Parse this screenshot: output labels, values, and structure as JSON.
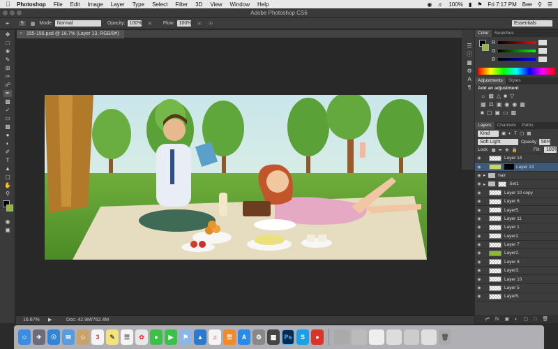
{
  "menubar": {
    "app": "Photoshop",
    "items": [
      "File",
      "Edit",
      "Image",
      "Layer",
      "Type",
      "Select",
      "Filter",
      "3D",
      "View",
      "Window",
      "Help"
    ],
    "battery": "100%",
    "clock": "Fri 7:17 PM",
    "user": "Bee"
  },
  "window": {
    "title": "Adobe Photoshop CS6"
  },
  "options": {
    "brush_size": "5",
    "mode_label": "Mode:",
    "mode_value": "Normal",
    "opacity_label": "Opacity:",
    "opacity_value": "100%",
    "flow_label": "Flow:",
    "flow_value": "100%",
    "workspace": "Essentials"
  },
  "document": {
    "tab": "155-156.psd @ 16.7% (Layer 13, RGB/8#)"
  },
  "status": {
    "zoom": "16.67%",
    "doc": "Doc: 42.9M/762.4M"
  },
  "color_panel": {
    "tabs": [
      "Color",
      "Swatches"
    ],
    "channels": [
      "R",
      "G",
      "B"
    ]
  },
  "adjustments_panel": {
    "tabs": [
      "Adjustments",
      "Styles"
    ],
    "heading": "Add an adjustment"
  },
  "layers_panel": {
    "tabs": [
      "Layers",
      "Channels",
      "Paths"
    ],
    "kind": "Kind",
    "blend_mode": "Soft Light",
    "opacity_label": "Opacity:",
    "opacity_value": "56%",
    "lock_label": "Lock:",
    "fill_label": "Fill:",
    "fill_value": "100%",
    "layers": [
      {
        "name": "Layer 14",
        "type": "layer"
      },
      {
        "name": "Layer 13",
        "type": "layer",
        "selected": true
      },
      {
        "name": "hair",
        "type": "group"
      },
      {
        "name": "Set1",
        "type": "group"
      },
      {
        "name": "Layer 10 copy",
        "type": "layer"
      },
      {
        "name": "Layer 6",
        "type": "layer"
      },
      {
        "name": "Layer5.",
        "type": "layer"
      },
      {
        "name": "Layer 11",
        "type": "layer"
      },
      {
        "name": "Layer 1",
        "type": "layer"
      },
      {
        "name": "Layer2.",
        "type": "layer"
      },
      {
        "name": "Layer 7",
        "type": "layer"
      },
      {
        "name": "Layer2.",
        "type": "layer"
      },
      {
        "name": "Layer 8",
        "type": "layer"
      },
      {
        "name": "Layer3.",
        "type": "layer"
      },
      {
        "name": "Layer 10",
        "type": "layer"
      },
      {
        "name": "Layer 5",
        "type": "layer"
      },
      {
        "name": "Layer5.",
        "type": "layer"
      }
    ]
  },
  "dock": {
    "ps_label": "Ps"
  }
}
